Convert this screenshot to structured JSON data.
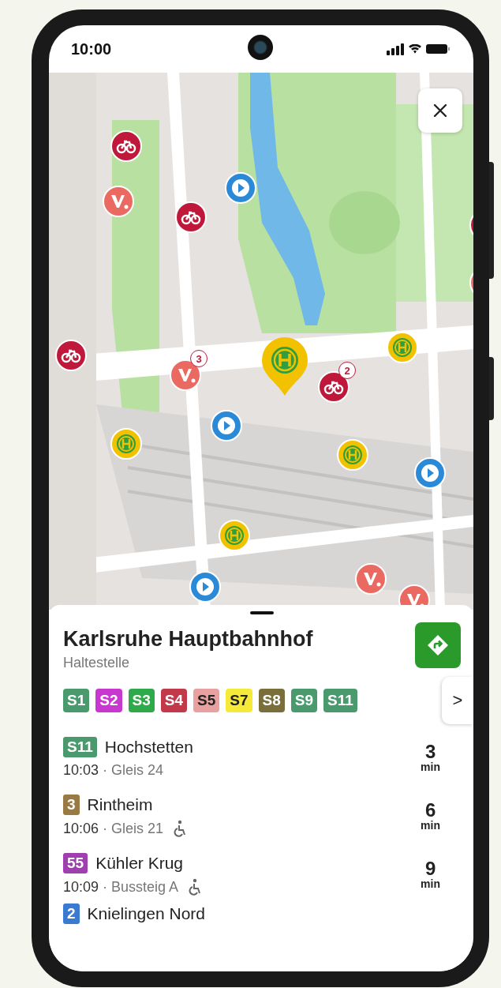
{
  "status_bar": {
    "time": "10:00"
  },
  "map": {
    "kind": "picture",
    "markers": [
      {
        "kind": "bike"
      },
      {
        "kind": "bike"
      },
      {
        "kind": "bike",
        "count": "2"
      },
      {
        "kind": "bike"
      },
      {
        "kind": "bike"
      },
      {
        "kind": "scooter"
      },
      {
        "kind": "scooter",
        "count": "3"
      },
      {
        "kind": "scooter"
      },
      {
        "kind": "scooter"
      },
      {
        "kind": "scooter"
      },
      {
        "kind": "stop"
      },
      {
        "kind": "stop"
      },
      {
        "kind": "stop"
      },
      {
        "kind": "stop"
      },
      {
        "kind": "play"
      },
      {
        "kind": "play"
      },
      {
        "kind": "play"
      },
      {
        "kind": "play"
      },
      {
        "kind": "selected_stop"
      }
    ]
  },
  "stop": {
    "name": "Karlsruhe Hauptbahnhof",
    "type": "Haltestelle"
  },
  "lines": [
    {
      "label": "S1",
      "color": "#4a9a6e"
    },
    {
      "label": "S2",
      "color": "#c837d0"
    },
    {
      "label": "S3",
      "color": "#2eaa4a"
    },
    {
      "label": "S4",
      "color": "#c23a4a"
    },
    {
      "label": "S5",
      "color": "#e8a0a0"
    },
    {
      "label": "S7",
      "color": "#f5ea3a"
    },
    {
      "label": "S8",
      "color": "#7a6e3a"
    },
    {
      "label": "S9",
      "color": "#4a9a6e"
    },
    {
      "label": "S11",
      "color": "#4a9a6e"
    }
  ],
  "more_lines": ">",
  "departures": [
    {
      "line": "S11",
      "color": "#4a9a6e",
      "destination": "Hochstetten",
      "time": "10:03",
      "sep": "·",
      "platform": "Gleis 24",
      "accessible": false,
      "minutes": "3",
      "unit": "min"
    },
    {
      "line": "3",
      "color": "#9a7a44",
      "destination": "Rintheim",
      "time": "10:06",
      "sep": "·",
      "platform": "Gleis 21",
      "accessible": true,
      "minutes": "6",
      "unit": "min"
    },
    {
      "line": "55",
      "color": "#a040b0",
      "destination": "Kühler Krug",
      "time": "10:09",
      "sep": "·",
      "platform": "Bussteig A",
      "accessible": true,
      "minutes": "9",
      "unit": "min"
    },
    {
      "line": "2",
      "color": "#3a7ad0",
      "destination": "Knielingen Nord"
    }
  ]
}
